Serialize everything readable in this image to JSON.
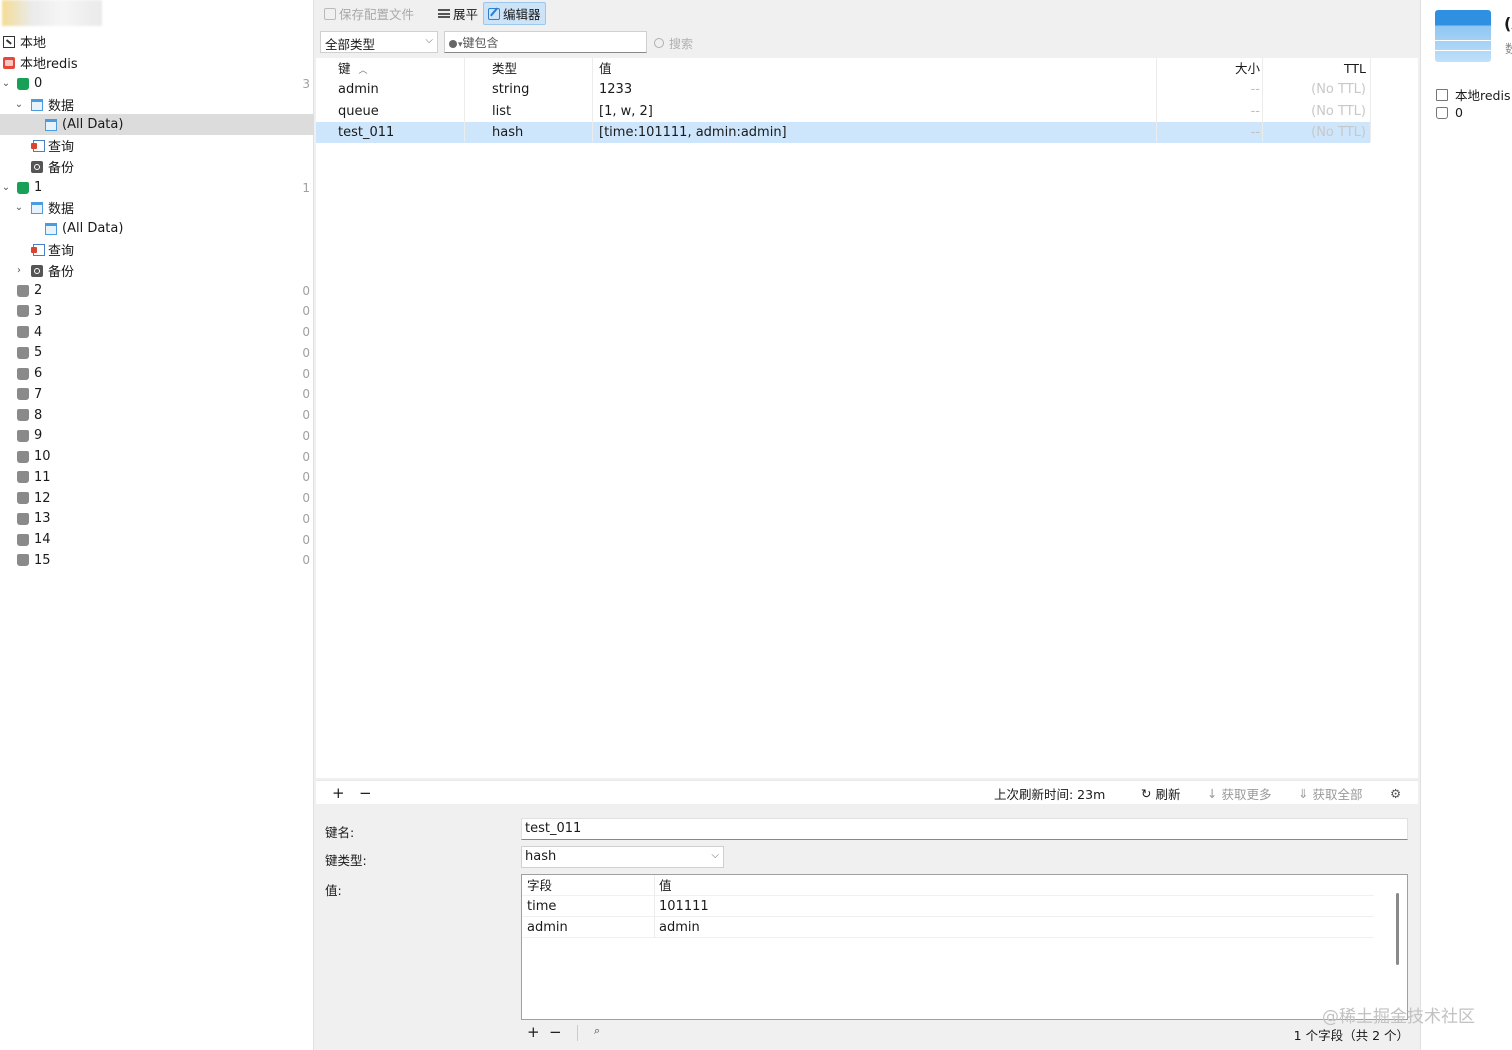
{
  "sidebar": {
    "connections": [
      {
        "label": "本地"
      },
      {
        "label": "本地redis"
      }
    ],
    "db0": {
      "label": "0",
      "count": "3",
      "data_label": "数据",
      "all_data": "(All Data)",
      "query": "查询",
      "backup": "备份"
    },
    "db1": {
      "label": "1",
      "count": "1",
      "data_label": "数据",
      "all_data": "(All Data)",
      "query": "查询",
      "backup": "备份"
    },
    "other_dbs": [
      {
        "label": "2",
        "count": "0"
      },
      {
        "label": "3",
        "count": "0"
      },
      {
        "label": "4",
        "count": "0"
      },
      {
        "label": "5",
        "count": "0"
      },
      {
        "label": "6",
        "count": "0"
      },
      {
        "label": "7",
        "count": "0"
      },
      {
        "label": "8",
        "count": "0"
      },
      {
        "label": "9",
        "count": "0"
      },
      {
        "label": "10",
        "count": "0"
      },
      {
        "label": "11",
        "count": "0"
      },
      {
        "label": "12",
        "count": "0"
      },
      {
        "label": "13",
        "count": "0"
      },
      {
        "label": "14",
        "count": "0"
      },
      {
        "label": "15",
        "count": "0"
      }
    ]
  },
  "toolbar": {
    "save_profile": "保存配置文件",
    "flat": "展平",
    "editor": "编辑器"
  },
  "filters": {
    "type_select": "全部类型",
    "key_filter": "键包含",
    "search": "搜索"
  },
  "key_table": {
    "headers": {
      "key": "键",
      "type": "类型",
      "value": "值",
      "size": "大小",
      "ttl": "TTL"
    },
    "rows": [
      {
        "key": "admin",
        "type": "string",
        "value": "1233",
        "size": "--",
        "ttl": "(No TTL)"
      },
      {
        "key": "queue",
        "type": "list",
        "value": "[1, w, 2]",
        "size": "--",
        "ttl": "(No TTL)"
      },
      {
        "key": "test_011",
        "type": "hash",
        "value": "[time:101111, admin:admin]",
        "size": "--",
        "ttl": "(No TTL)"
      }
    ]
  },
  "action_bar": {
    "add": "+",
    "remove": "−",
    "last_refresh": "上次刷新时间: 23m",
    "refresh": "刷新",
    "fetch_more": "获取更多",
    "fetch_all": "获取全部"
  },
  "editor": {
    "key_name_label": "键名:",
    "key_name": "test_011",
    "key_type_label": "键类型:",
    "key_type": "hash",
    "value_label": "值:",
    "field_header": "字段",
    "value_header": "值",
    "fields": [
      {
        "field": "time",
        "value": "101111"
      },
      {
        "field": "admin",
        "value": "admin"
      }
    ],
    "add": "+",
    "remove": "−",
    "status": "1 个字段（共 2 个）"
  },
  "right_panel": {
    "title_partial": "(A",
    "subtitle_partial": "数",
    "connection": "本地redis",
    "db": "0"
  },
  "watermark": "@稀土掘金技术社区"
}
